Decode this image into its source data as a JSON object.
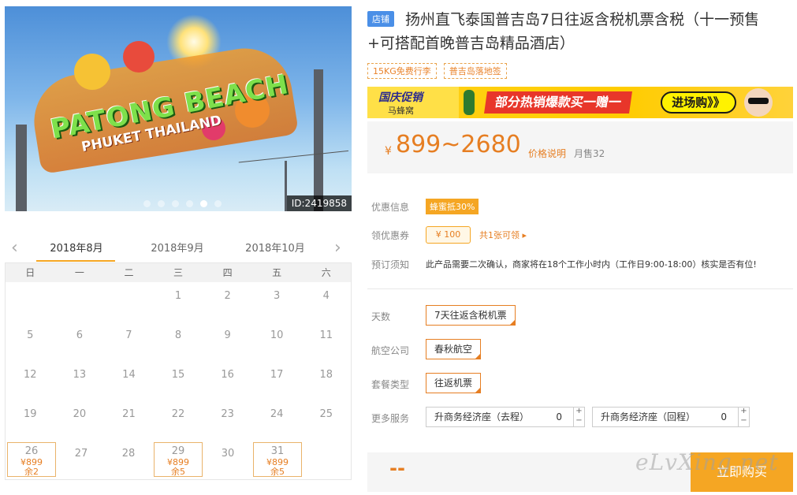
{
  "hero": {
    "title_line1": "PATONG BEACH",
    "title_line2": "PHUKET THAILAND",
    "photo_id": "ID:2419858",
    "carousel_dots": 6,
    "active_dot": 5
  },
  "calendar_nav": {
    "prev_arrow": "‹",
    "next_arrow": "›",
    "months": [
      "2018年8月",
      "2018年9月",
      "2018年10月"
    ],
    "active_month": "2018年8月"
  },
  "calendar": {
    "weekdays": [
      "日",
      "一",
      "二",
      "三",
      "四",
      "五",
      "六"
    ],
    "rows": [
      [
        {
          "d": ""
        },
        {
          "d": ""
        },
        {
          "d": ""
        },
        {
          "d": "1"
        },
        {
          "d": "2"
        },
        {
          "d": "3"
        },
        {
          "d": "4"
        }
      ],
      [
        {
          "d": "5"
        },
        {
          "d": "6"
        },
        {
          "d": "7"
        },
        {
          "d": "8"
        },
        {
          "d": "9"
        },
        {
          "d": "10"
        },
        {
          "d": "11"
        }
      ],
      [
        {
          "d": "12"
        },
        {
          "d": "13"
        },
        {
          "d": "14"
        },
        {
          "d": "15"
        },
        {
          "d": "16"
        },
        {
          "d": "17"
        },
        {
          "d": "18"
        }
      ],
      [
        {
          "d": "19"
        },
        {
          "d": "20"
        },
        {
          "d": "21"
        },
        {
          "d": "22"
        },
        {
          "d": "23"
        },
        {
          "d": "24"
        },
        {
          "d": "25"
        }
      ],
      [
        {
          "d": "26",
          "price": "¥899",
          "remain": "余2"
        },
        {
          "d": "27"
        },
        {
          "d": "28"
        },
        {
          "d": "29",
          "price": "¥899",
          "remain": "余5"
        },
        {
          "d": "30"
        },
        {
          "d": "31",
          "price": "¥899",
          "remain": "余5"
        },
        {
          "d": ""
        }
      ]
    ]
  },
  "product": {
    "store_tag": "店铺",
    "title": "扬州直飞泰国普吉岛7日往返含税机票含税（十一预售+可搭配首晚普吉岛精品酒店）",
    "tags": [
      "15KG免费行李",
      "普吉岛落地签"
    ]
  },
  "banner": {
    "promo_title": "国庆促销",
    "promo_sub": "马蜂窝",
    "center_text": "部分热销爆款买一赠一",
    "button": "进场购》》"
  },
  "price": {
    "yen": "¥",
    "range": "899~2680",
    "explain": "价格说明",
    "sales": "月售32"
  },
  "info": {
    "discount_label": "优惠信息",
    "discount_badge": "蜂蜜抵30%",
    "coupon_label": "领优惠券",
    "coupon_value": "¥ 100",
    "coupon_link": "共1张可领 ▸",
    "notice_label": "预订须知",
    "notice_text": "此产品需要二次确认，商家将在18个工作小时内（工作日9:00-18:00）核实是否有位!"
  },
  "options": {
    "days_label": "天数",
    "days_value": "7天往返含税机票",
    "airline_label": "航空公司",
    "airline_value": "春秋航空",
    "package_label": "套餐类型",
    "package_value": "往返机票",
    "services_label": "更多服务",
    "service1_name": "升商务经济座（去程）",
    "service1_qty": "0",
    "service2_name": "升商务经济座（回程）",
    "service2_qty": "0",
    "plus": "+",
    "minus": "−"
  },
  "buy": {
    "total": "--",
    "button": "立即购买"
  },
  "watermark": "eLvXing.net"
}
